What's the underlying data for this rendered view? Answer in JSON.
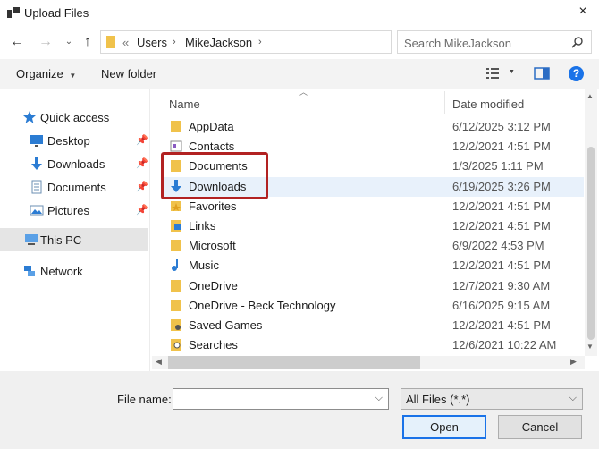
{
  "window": {
    "title": "Upload Files",
    "close": "×"
  },
  "nav": {
    "back": "←",
    "forward": "→",
    "up": "↑",
    "breadcrumb": [
      "Users",
      "MikeJackson"
    ],
    "search_placeholder": "Search MikeJackson"
  },
  "toolbar": {
    "organize": "Organize",
    "new_folder": "New folder",
    "help": "?"
  },
  "sidebar": {
    "items": [
      {
        "label": "Quick access",
        "icon": "star-icon"
      },
      {
        "label": "Desktop",
        "icon": "desktop-icon",
        "pinned": true
      },
      {
        "label": "Downloads",
        "icon": "download-icon",
        "pinned": true
      },
      {
        "label": "Documents",
        "icon": "document-icon",
        "pinned": true
      },
      {
        "label": "Pictures",
        "icon": "picture-icon",
        "pinned": true
      },
      {
        "label": "This PC",
        "icon": "pc-icon",
        "selected": true
      },
      {
        "label": "Network",
        "icon": "network-icon"
      }
    ]
  },
  "columns": {
    "name": "Name",
    "date": "Date modified"
  },
  "files": [
    {
      "name": "AppData",
      "date": "6/12/2025 3:12 PM",
      "icon": "folder-icon"
    },
    {
      "name": "Contacts",
      "date": "12/2/2021 4:51 PM",
      "icon": "contacts-icon"
    },
    {
      "name": "Documents",
      "date": "1/3/2025 1:11 PM",
      "icon": "folder-icon"
    },
    {
      "name": "Downloads",
      "date": "6/19/2025 3:26 PM",
      "icon": "download-icon",
      "highlighted": true
    },
    {
      "name": "Favorites",
      "date": "12/2/2021 4:51 PM",
      "icon": "favorites-icon"
    },
    {
      "name": "Links",
      "date": "12/2/2021 4:51 PM",
      "icon": "links-icon"
    },
    {
      "name": "Microsoft",
      "date": "6/9/2022 4:53 PM",
      "icon": "folder-icon"
    },
    {
      "name": "Music",
      "date": "12/2/2021 4:51 PM",
      "icon": "music-icon"
    },
    {
      "name": "OneDrive",
      "date": "12/7/2021 9:30 AM",
      "icon": "folder-icon"
    },
    {
      "name": "OneDrive - Beck Technology",
      "date": "6/16/2025 9:15 AM",
      "icon": "folder-icon"
    },
    {
      "name": "Saved Games",
      "date": "12/2/2021 4:51 PM",
      "icon": "games-icon"
    },
    {
      "name": "Searches",
      "date": "12/6/2021 10:22 AM",
      "icon": "search-folder-icon"
    }
  ],
  "footer": {
    "file_name_label": "File name:",
    "file_name_value": "",
    "file_type": "All Files (*.*)",
    "open": "Open",
    "cancel": "Cancel"
  },
  "colors": {
    "accent": "#1a73e8",
    "highlight_box": "#b22222",
    "folder": "#f0c24b"
  }
}
